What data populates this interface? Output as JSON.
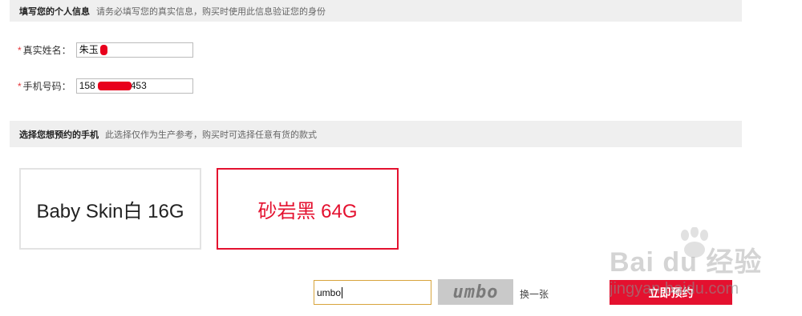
{
  "personal_section": {
    "title": "填写您的个人信息",
    "description": "请务必填写您的真实信息，购买时使用此信息验证您的身份"
  },
  "name_field": {
    "required_mark": "*",
    "label": "真实姓名：",
    "value": "朱玉"
  },
  "phone_field": {
    "required_mark": "*",
    "label": "手机号码：",
    "value_prefix": "158",
    "value_suffix": "453"
  },
  "phone_section": {
    "title": "选择您想预约的手机",
    "description": "此选择仅作为生产参考，购买时可选择任意有货的款式"
  },
  "options": [
    {
      "label": "Baby Skin白 16G",
      "selected": false
    },
    {
      "label": "砂岩黑 64G",
      "selected": true
    }
  ],
  "captcha": {
    "input_value": "umbo",
    "image_text": "umbo",
    "refresh_label": "换一张"
  },
  "reserve_button_label": "立即预约",
  "watermark": {
    "top": "Bai du 经验",
    "bottom": "jingyan.baidu.com"
  },
  "colors": {
    "accent": "#e4112f",
    "section_bg": "#efefef"
  }
}
